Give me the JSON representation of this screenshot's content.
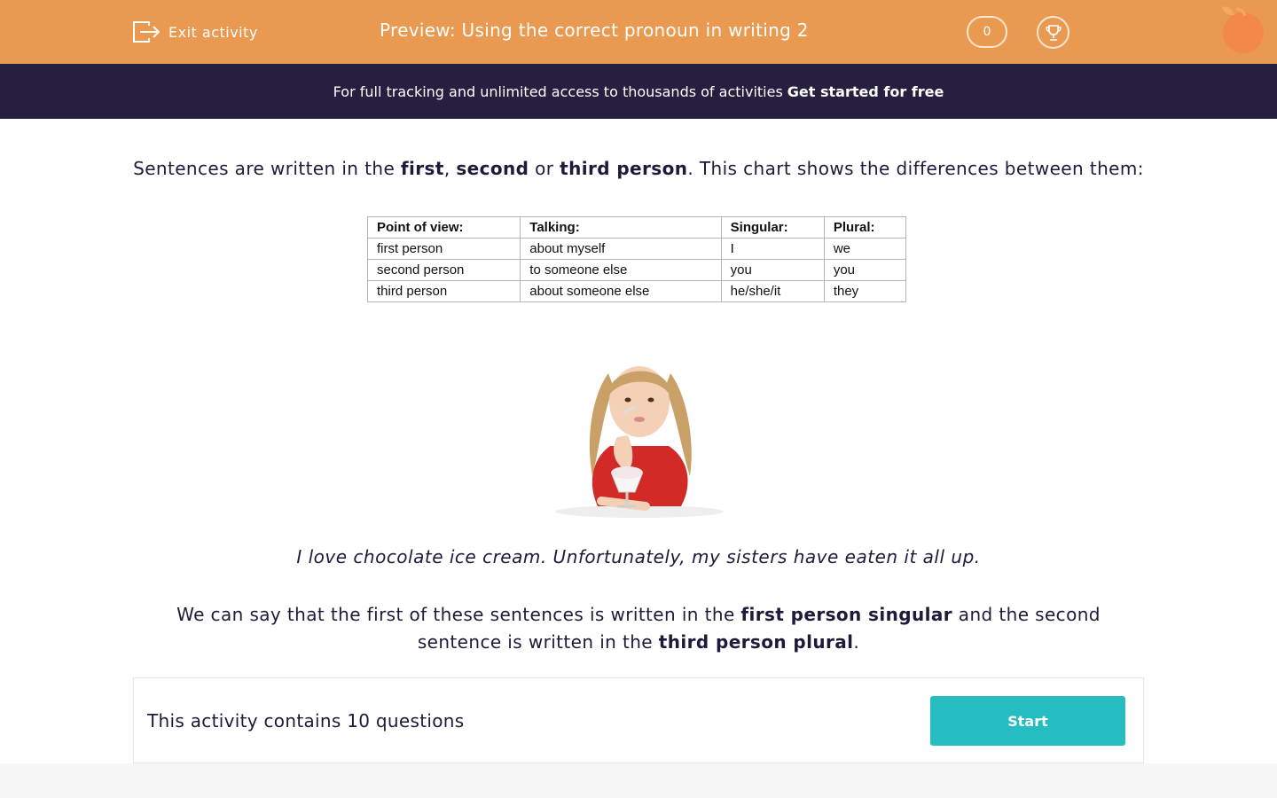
{
  "header": {
    "exit_label": "Exit activity",
    "title": "Preview: Using the correct pronoun in writing 2",
    "score": "0",
    "icons": {
      "exit": "exit-icon",
      "trophy": "trophy-icon",
      "brand": "orange-logo"
    },
    "colors": {
      "bar": "#ea9a50",
      "text": "#ffffff"
    }
  },
  "banner": {
    "text": "For full tracking and unlimited access to thousands of activities",
    "cta": "Get started for free",
    "color": "#271f3f"
  },
  "content": {
    "intro": {
      "t1": "Sentences are written in the ",
      "b1": "first",
      "t2": ", ",
      "b2": "second",
      "t3": " or ",
      "b3": "third person",
      "t4": ". This chart shows the differences between them:"
    },
    "table": {
      "headers": [
        "Point of view",
        "Talking",
        "Singular",
        "Plural"
      ],
      "header_suffix": ":",
      "rows": [
        [
          "first person",
          "about myself",
          "I",
          "we"
        ],
        [
          "second person",
          "to someone else",
          "you",
          "you"
        ],
        [
          "third person",
          "about someone else",
          "he/she/it",
          "they"
        ]
      ]
    },
    "image": {
      "subject": "girl-eating-ice-cream"
    },
    "example": "I love chocolate ice cream. Unfortunately, my sisters have eaten it all up.",
    "explain": {
      "t1": "We can say that the first of these sentences is written in the ",
      "b1": "first person singular",
      "t2": " and the second sentence is written in the ",
      "b2": "third person plural",
      "t3": "."
    }
  },
  "activity": {
    "summary": "This activity contains 10 questions",
    "start_label": "Start",
    "button_color": "#25bdbf"
  }
}
